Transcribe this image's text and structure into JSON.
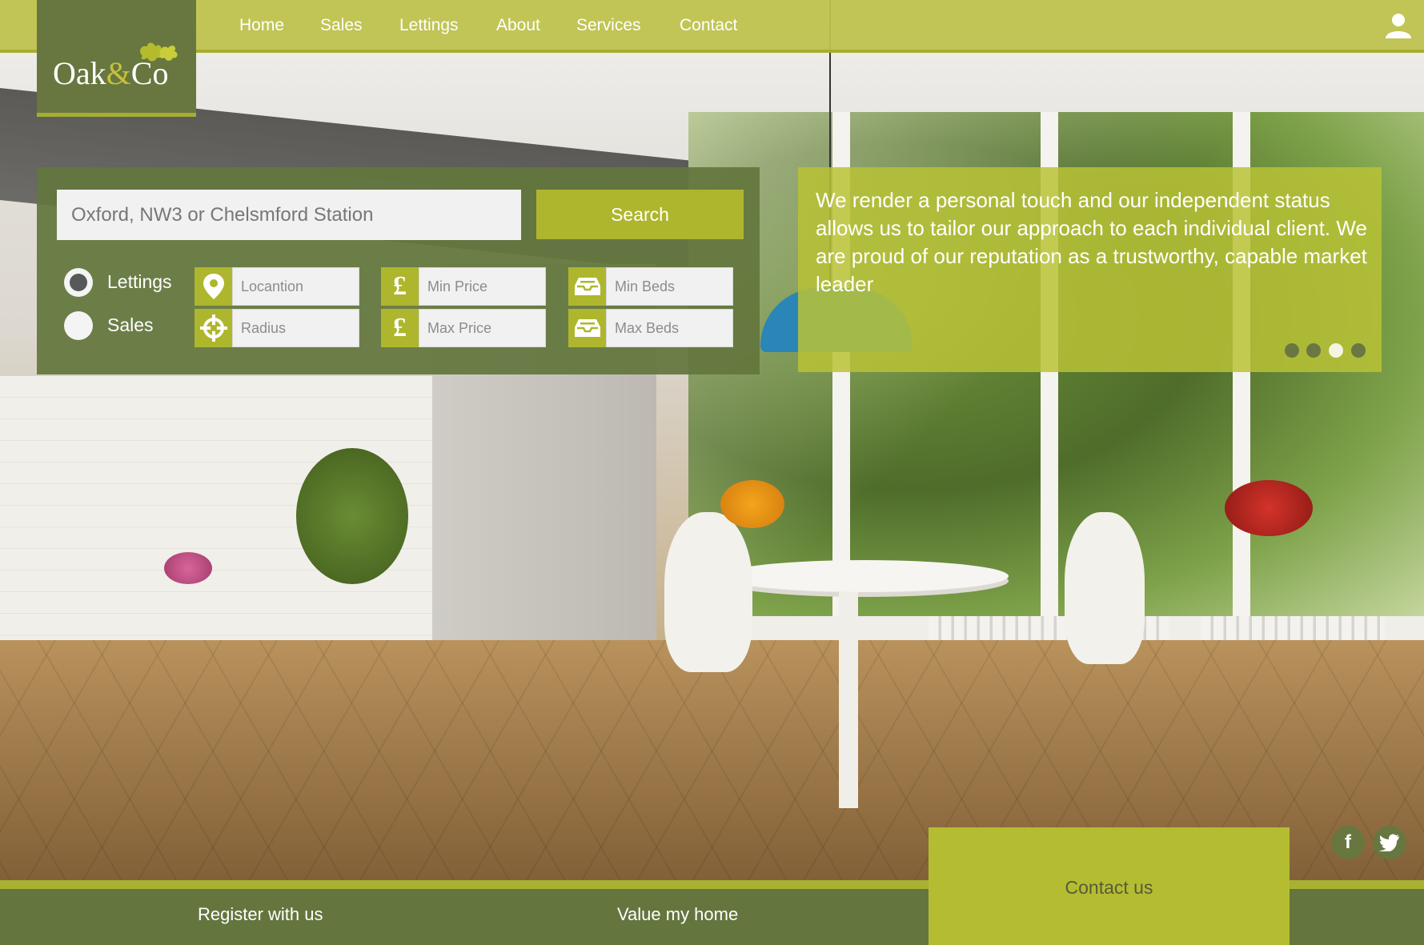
{
  "brand": {
    "name_part1": "Oak",
    "name_amp": "&",
    "name_part2": "Co"
  },
  "nav": {
    "items": [
      {
        "label": "Home"
      },
      {
        "label": "Sales"
      },
      {
        "label": "Lettings"
      },
      {
        "label": "About"
      },
      {
        "label": "Services"
      },
      {
        "label": "Contact"
      }
    ],
    "user_icon": "user-icon"
  },
  "search": {
    "placeholder": "Oxford, NW3 or Chelsmford Station",
    "button_label": "Search",
    "mode_options": [
      {
        "label": "Lettings",
        "selected": true
      },
      {
        "label": "Sales",
        "selected": false
      }
    ],
    "fields": [
      {
        "placeholder": "Locantion",
        "icon": "location-pin-icon"
      },
      {
        "placeholder": "Radius",
        "icon": "crosshair-icon"
      },
      {
        "placeholder": "Min Price",
        "icon": "pound-icon"
      },
      {
        "placeholder": "Max Price",
        "icon": "pound-icon"
      },
      {
        "placeholder": "Min Beds",
        "icon": "inbox-tray-icon"
      },
      {
        "placeholder": "Max Beds",
        "icon": "inbox-tray-icon"
      }
    ]
  },
  "info": {
    "text": "We render a personal touch and our independent status allows us to tailor our approach to each individual client. We are proud of our reputation as a trustworthy, capable market leader",
    "slides": 4,
    "active_slide": 3
  },
  "social": {
    "facebook": "f",
    "twitter_icon": "twitter-bird-icon"
  },
  "footer": {
    "register_label": "Register with us",
    "value_label": "Value my home",
    "contact_label": "Contact us"
  },
  "colors": {
    "accent_lime": "#aeb62d",
    "olive_dark": "#65753e",
    "nav_bar": "#bec24e"
  }
}
